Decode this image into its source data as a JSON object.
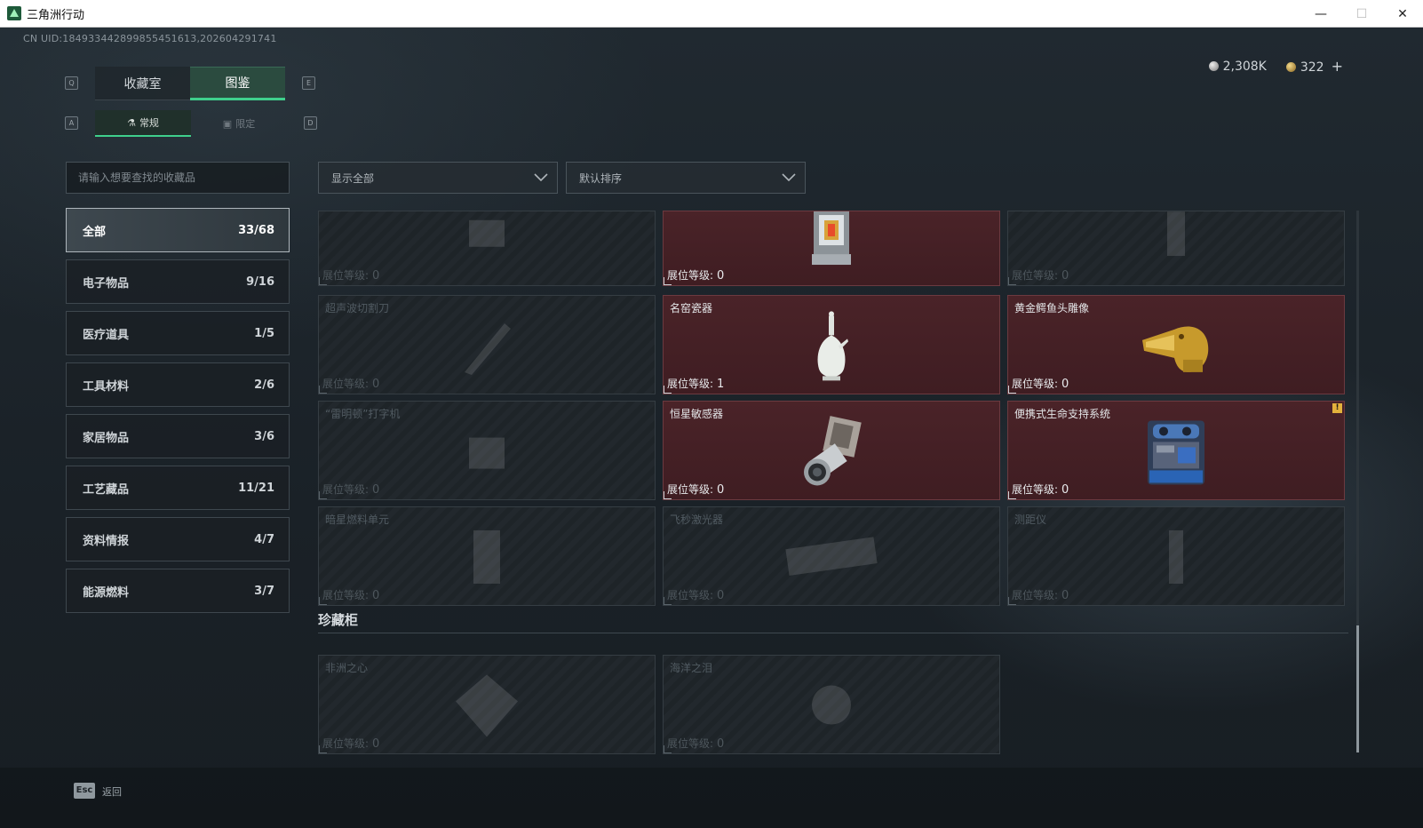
{
  "window": {
    "title": "三角洲行动"
  },
  "uid": "CN UID:184933442899855451613,202604291741",
  "currency": {
    "silver": "2,308K",
    "gold": "322",
    "plus": "+"
  },
  "keys": {
    "q": "Q",
    "e": "E",
    "a": "A",
    "d": "D"
  },
  "tabs_main": [
    {
      "label": "收藏室",
      "active": false
    },
    {
      "label": "图鉴",
      "active": true
    }
  ],
  "tabs_sub": [
    {
      "label": "常规",
      "active": true
    },
    {
      "label": "限定",
      "active": false
    }
  ],
  "search": {
    "placeholder": "请输入想要查找的收藏品"
  },
  "filters": {
    "show": "显示全部",
    "sort": "默认排序"
  },
  "categories": [
    {
      "label": "全部",
      "count": "33/68"
    },
    {
      "label": "电子物品",
      "count": "9/16"
    },
    {
      "label": "医疗道具",
      "count": "1/5"
    },
    {
      "label": "工具材料",
      "count": "2/6"
    },
    {
      "label": "家居物品",
      "count": "3/6"
    },
    {
      "label": "工艺藏品",
      "count": "11/21"
    },
    {
      "label": "资料情报",
      "count": "4/7"
    },
    {
      "label": "能源燃料",
      "count": "3/7"
    }
  ],
  "level_label": "展位等级:",
  "items": [
    {
      "name": "",
      "level": "0",
      "owned": false,
      "icon": "unknown-item-icon"
    },
    {
      "name": "",
      "level": "0",
      "owned": true,
      "icon": "lantern-device-icon"
    },
    {
      "name": "",
      "level": "0",
      "owned": false,
      "icon": "unknown-item-icon"
    },
    {
      "name": "超声波切割刀",
      "level": "0",
      "owned": false,
      "icon": "cutting-knife-icon"
    },
    {
      "name": "名窑瓷器",
      "level": "1",
      "owned": true,
      "icon": "porcelain-vase-icon"
    },
    {
      "name": "黄金鳄鱼头雕像",
      "level": "0",
      "owned": true,
      "icon": "gold-crocodile-icon"
    },
    {
      "name": "“雷明顿”打字机",
      "level": "0",
      "owned": false,
      "icon": "typewriter-icon"
    },
    {
      "name": "恒星敏感器",
      "level": "0",
      "owned": true,
      "icon": "star-sensor-icon"
    },
    {
      "name": "便携式生命支持系统",
      "level": "0",
      "owned": true,
      "icon": "life-support-icon",
      "warning": "!"
    },
    {
      "name": "暗星燃料单元",
      "level": "0",
      "owned": false,
      "icon": "fuel-cell-icon"
    },
    {
      "name": "飞秒激光器",
      "level": "0",
      "owned": false,
      "icon": "laser-icon"
    },
    {
      "name": "测距仪",
      "level": "0",
      "owned": false,
      "icon": "rangefinder-icon"
    }
  ],
  "section": {
    "title": "珍藏柜"
  },
  "treasures": [
    {
      "name": "非洲之心",
      "level": "0",
      "owned": false,
      "icon": "diamond-icon"
    },
    {
      "name": "海洋之泪",
      "level": "0",
      "owned": false,
      "icon": "pearl-icon"
    }
  ],
  "footer": {
    "esc": "Esc",
    "back": "返回"
  },
  "colors": {
    "accent": "#3fd08c",
    "owned_card": "#4a2328",
    "warning": "#e3b23c"
  }
}
